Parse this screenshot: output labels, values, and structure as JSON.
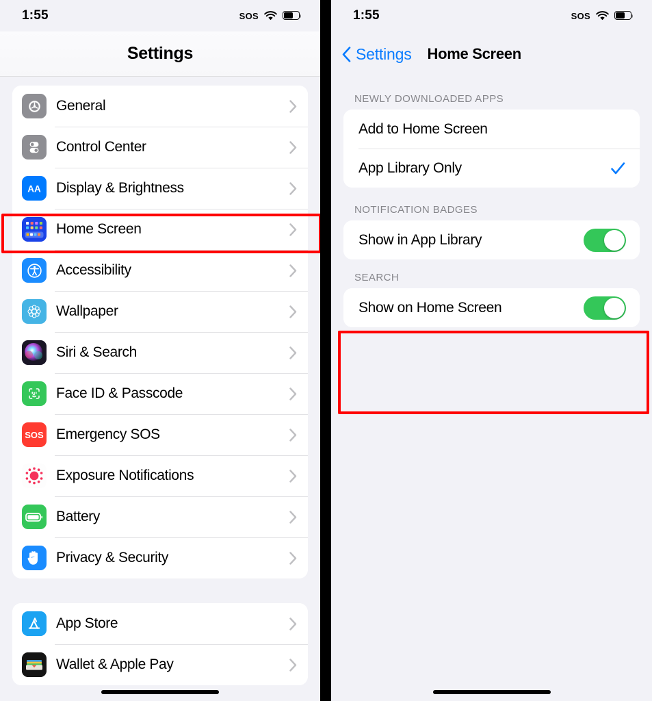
{
  "statusbar": {
    "time": "1:55",
    "sos_label": "SOS",
    "wifi_icon": "wifi-icon",
    "battery_icon": "battery-icon",
    "battery_level_pct": 60
  },
  "left_panel": {
    "nav_title": "Settings",
    "groups": [
      {
        "items": [
          {
            "label": "General",
            "icon": "gear-icon",
            "icon_color": "#8e8e93",
            "chevron": "chevron-right-icon"
          },
          {
            "label": "Control Center",
            "icon": "control-center-icon",
            "icon_color": "#8e8e93",
            "chevron": "chevron-right-icon"
          },
          {
            "label": "Display & Brightness",
            "icon": "display-brightness-icon",
            "icon_color": "#007aff",
            "chevron": "chevron-right-icon"
          },
          {
            "label": "Home Screen",
            "icon": "home-screen-icon",
            "icon_color": "#1a43e8",
            "chevron": "chevron-right-icon",
            "highlighted": true
          },
          {
            "label": "Accessibility",
            "icon": "accessibility-icon",
            "icon_color": "#1a8cff",
            "chevron": "chevron-right-icon"
          },
          {
            "label": "Wallpaper",
            "icon": "wallpaper-icon",
            "icon_color": "#45b4e5",
            "chevron": "chevron-right-icon"
          },
          {
            "label": "Siri & Search",
            "icon": "siri-search-icon",
            "icon_color": "#24203a",
            "chevron": "chevron-right-icon"
          },
          {
            "label": "Face ID & Passcode",
            "icon": "face-id-icon",
            "icon_color": "#34c759",
            "chevron": "chevron-right-icon"
          },
          {
            "label": "Emergency SOS",
            "icon": "emergency-sos-icon",
            "icon_color": "#ff3b30",
            "chevron": "chevron-right-icon"
          },
          {
            "label": "Exposure Notifications",
            "icon": "exposure-notifications-icon",
            "icon_color": "#ffffff",
            "chevron": "chevron-right-icon"
          },
          {
            "label": "Battery",
            "icon": "battery-settings-icon",
            "icon_color": "#34c759",
            "chevron": "chevron-right-icon"
          },
          {
            "label": "Privacy & Security",
            "icon": "privacy-security-icon",
            "icon_color": "#1a8cff",
            "chevron": "chevron-right-icon"
          }
        ]
      },
      {
        "items": [
          {
            "label": "App Store",
            "icon": "app-store-icon",
            "icon_color": "#1ba3f2",
            "chevron": "chevron-right-icon"
          },
          {
            "label": "Wallet & Apple Pay",
            "icon": "wallet-icon",
            "icon_color": "#1c1c1e",
            "chevron": "chevron-right-icon"
          }
        ]
      }
    ]
  },
  "right_panel": {
    "back_label": "Settings",
    "back_icon": "chevron-left-icon",
    "nav_title": "Home Screen",
    "sections": [
      {
        "header": "NEWLY DOWNLOADED APPS",
        "rows": [
          {
            "label": "Add to Home Screen",
            "control": "none",
            "checked": false
          },
          {
            "label": "App Library Only",
            "control": "checkmark",
            "checked": true
          }
        ]
      },
      {
        "header": "NOTIFICATION BADGES",
        "rows": [
          {
            "label": "Show in App Library",
            "control": "switch",
            "switch_on": true
          }
        ]
      },
      {
        "header": "SEARCH",
        "highlighted": true,
        "rows": [
          {
            "label": "Show on Home Screen",
            "control": "switch",
            "switch_on": true
          }
        ]
      }
    ]
  },
  "colors": {
    "accent_blue": "#0a7cff",
    "switch_on_green": "#34c759",
    "annotation_red": "#ff0000",
    "page_background": "#f2f2f7",
    "group_background": "#ffffff",
    "section_header_gray": "#86868b"
  }
}
